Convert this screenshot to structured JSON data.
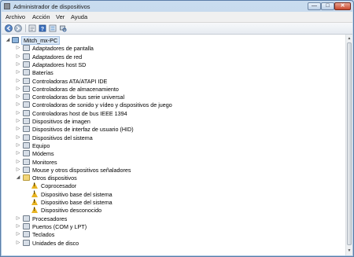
{
  "window": {
    "title": "Administrador de dispositivos",
    "minimize_icon": "minimize-icon",
    "maximize_icon": "maximize-icon",
    "close_icon": "close-icon"
  },
  "menu": [
    "Archivo",
    "Acción",
    "Ver",
    "Ayuda"
  ],
  "toolbar": [
    "back-icon",
    "forward-icon",
    "properties-icon",
    "help-icon",
    "scan-hardware-icon"
  ],
  "tree": {
    "root": "Mitch_mx-PC",
    "categories": [
      "Adaptadores de pantalla",
      "Adaptadores de red",
      "Adaptadores host SD",
      "Baterías",
      "Controladoras ATA/ATAPI IDE",
      "Controladoras de almacenamiento",
      "Controladoras de bus serie universal",
      "Controladoras de sonido y vídeo y dispositivos de juego",
      "Controladoras host de bus IEEE 1394",
      "Dispositivos de imagen",
      "Dispositivos de interfaz de usuario (HID)",
      "Dispositivos del sistema",
      "Equipo",
      "Módems",
      "Monitores",
      "Mouse y otros dispositivos señaladores",
      "Otros dispositivos"
    ],
    "other_devices": [
      "Coprocesador",
      "Dispositivo base del sistema",
      "Dispositivo base del sistema",
      "Dispositivo desconocido"
    ],
    "after": [
      "Procesadores",
      "Puertos (COM y LPT)",
      "Teclados",
      "Unidades de disco"
    ]
  },
  "colors": {
    "warning": "#e8b421",
    "selection": "#d9e7f6"
  }
}
